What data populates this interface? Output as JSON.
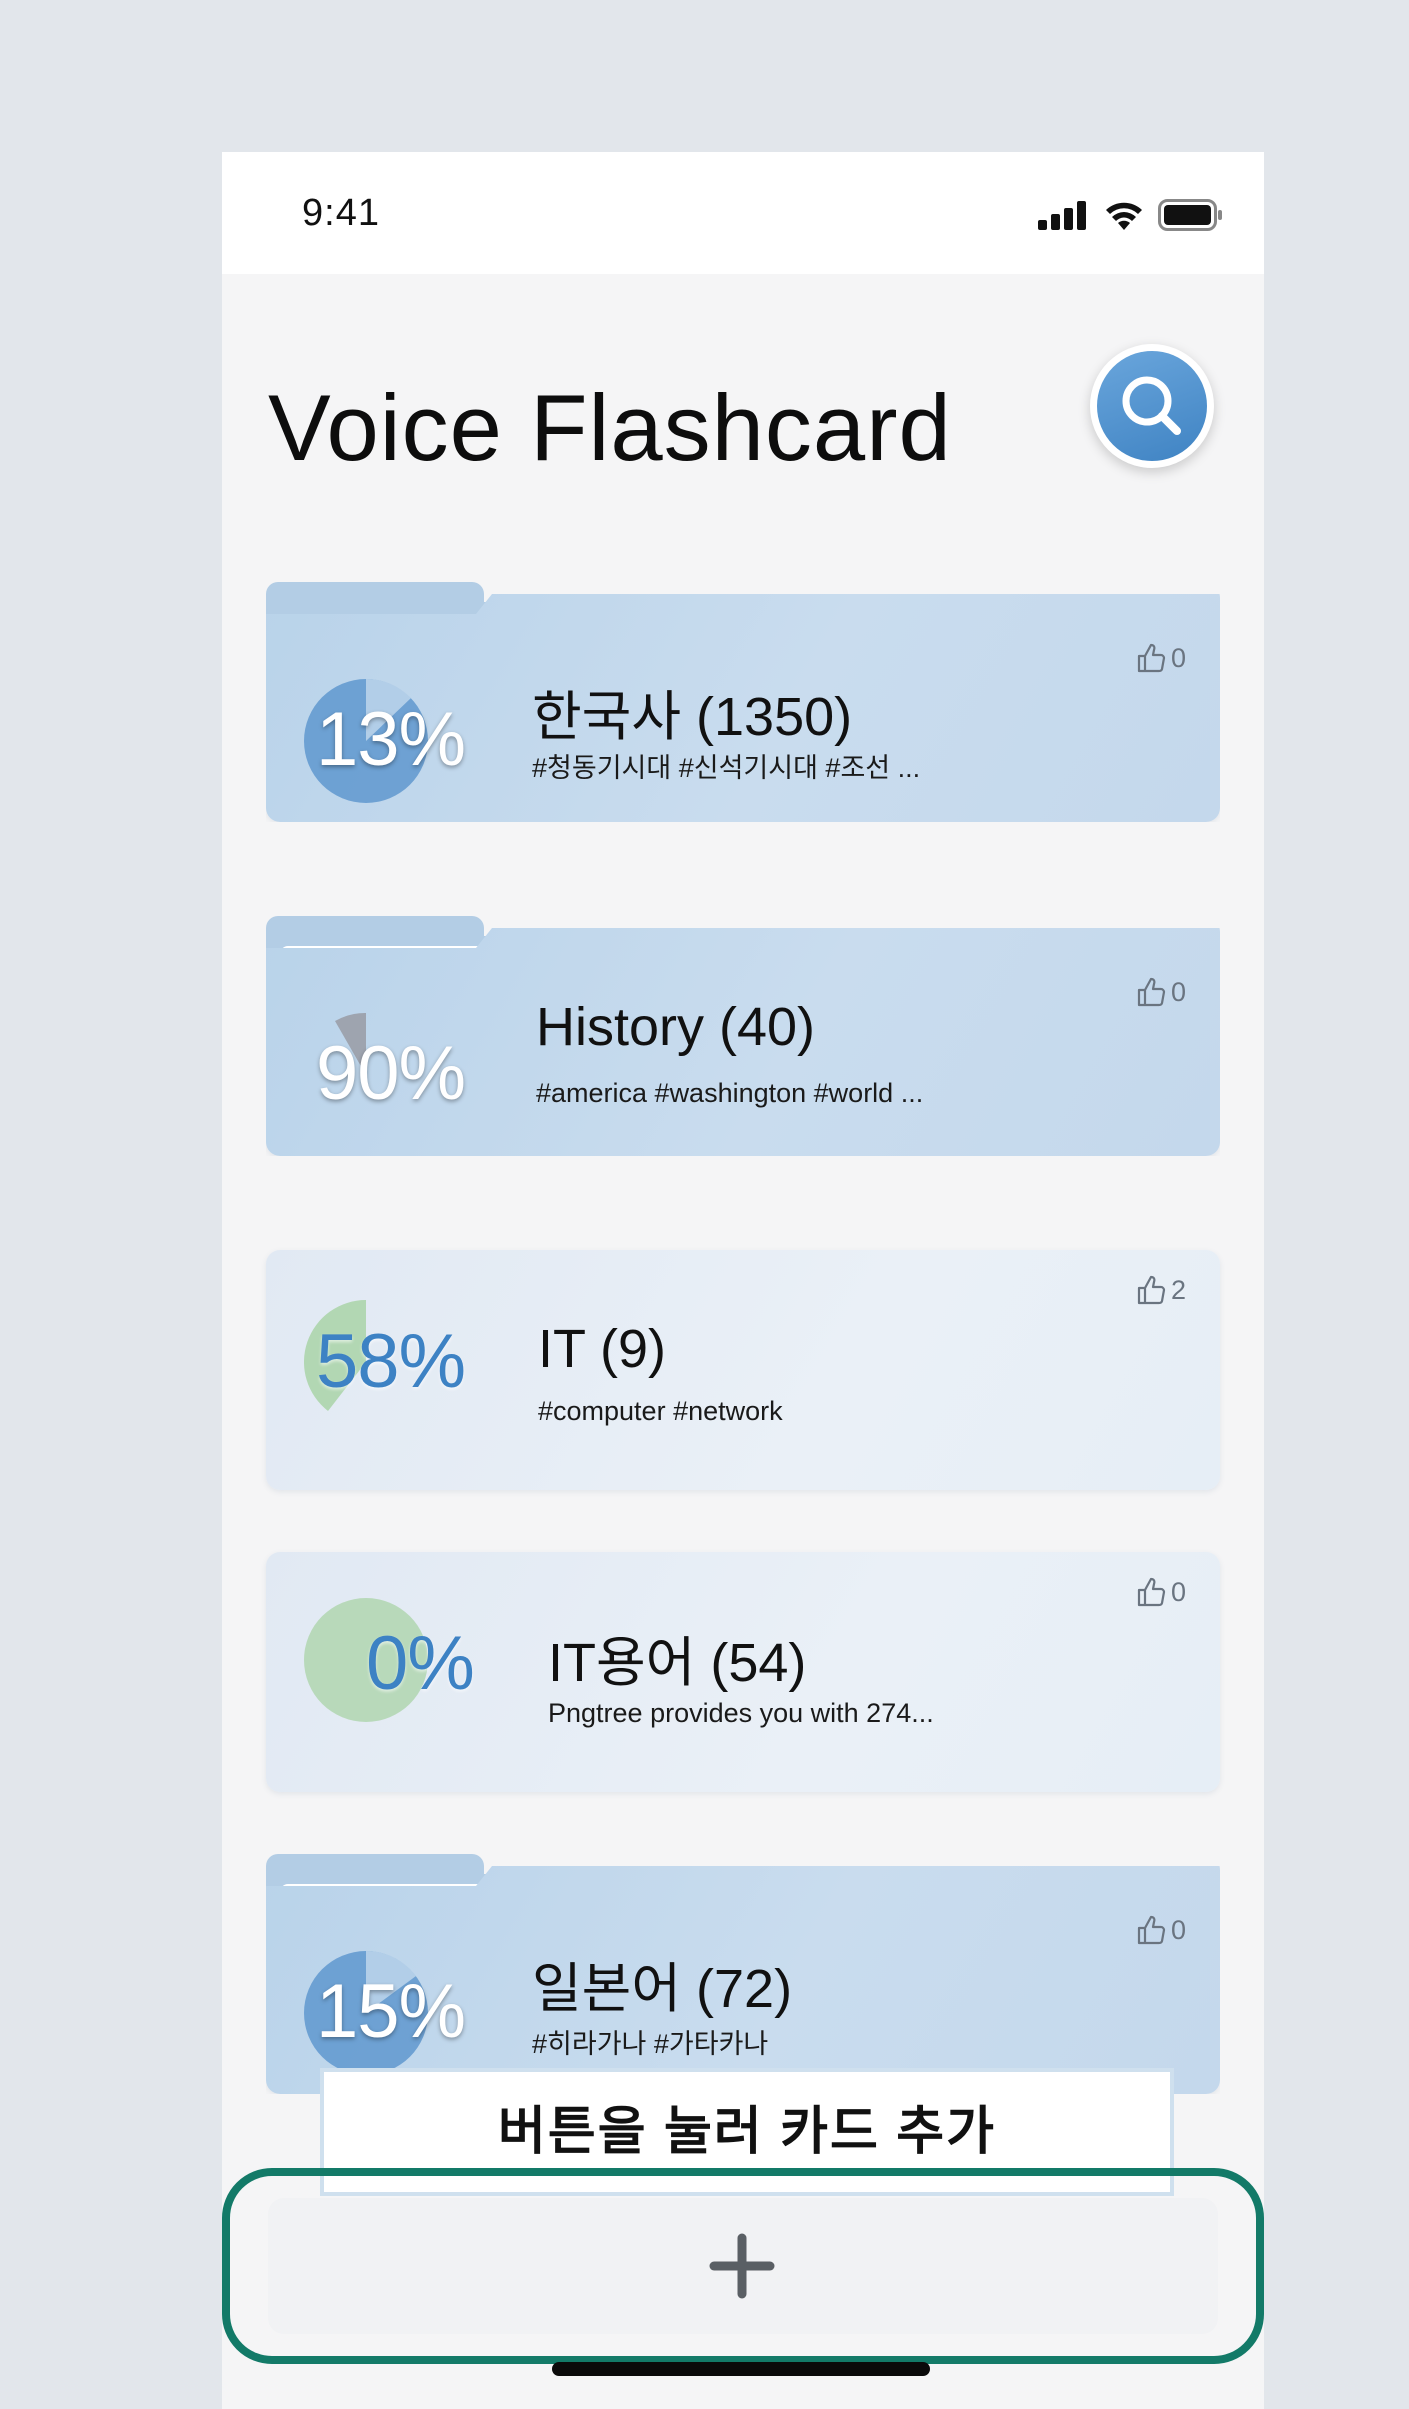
{
  "status_bar": {
    "time": "9:41"
  },
  "header": {
    "title": "Voice Flashcard"
  },
  "cards": [
    {
      "title": "한국사 (1350)",
      "tags": "#청동기시대 #신석기시대 #조선 ...",
      "progress_label": "13%",
      "progress": 13,
      "likes": "0"
    },
    {
      "title": "History (40)",
      "tags": "#america #washington #world ...",
      "progress_label": "90%",
      "progress": 90,
      "likes": "0"
    },
    {
      "title": "IT (9)",
      "tags": "#computer #network",
      "progress_label": "58%",
      "progress": 58,
      "likes": "2"
    },
    {
      "title": "IT용어 (54)",
      "tags": "Pngtree provides you with 274...",
      "progress_label": "0%",
      "progress": 0,
      "likes": "0"
    },
    {
      "title": "일본어 (72)",
      "tags": "#히라가나 #가타카나",
      "progress_label": "15%",
      "progress": 15,
      "likes": "0"
    }
  ],
  "tooltip": {
    "text": "버튼을 눌러 카드 추가"
  },
  "colors": {
    "accent": "#3f83c3",
    "highlight_frame": "#137a68",
    "card_blue": "#b9d3ea",
    "card_light": "#e6eef6",
    "pie_green": "#a9d3a7"
  },
  "icons": {
    "search": "search-icon",
    "like": "thumbs-up-icon",
    "add": "plus-icon"
  }
}
